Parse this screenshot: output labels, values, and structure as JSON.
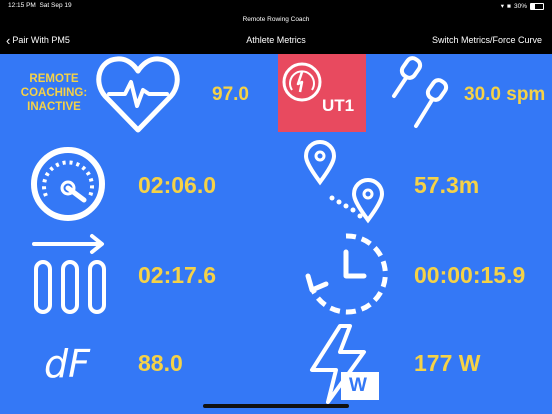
{
  "status": {
    "time": "12:15 PM",
    "date": "Sat Sep 19",
    "battery": "30%"
  },
  "app_title": "Remote Rowing Coach",
  "nav": {
    "back_label": "Pair With PM5",
    "title": "Athlete Metrics",
    "right_label": "Switch Metrics/Force Curve"
  },
  "coaching": {
    "line1": "REMOTE",
    "line2": "COACHING:",
    "line3": "INACTIVE"
  },
  "metrics": {
    "heart_rate": "97.0",
    "zone": "UT1",
    "stroke_rate": "30.0 spm",
    "split": "02:06.0",
    "distance": "57.3m",
    "avg_split": "02:17.6",
    "elapsed": "00:00:15.9",
    "drive_force": "88.0",
    "drive_force_label": "dF",
    "power": "177 W",
    "power_badge": "W"
  },
  "colors": {
    "background": "#3478F6",
    "value": "#F5D247",
    "zone_badge": "#E84A5F"
  }
}
